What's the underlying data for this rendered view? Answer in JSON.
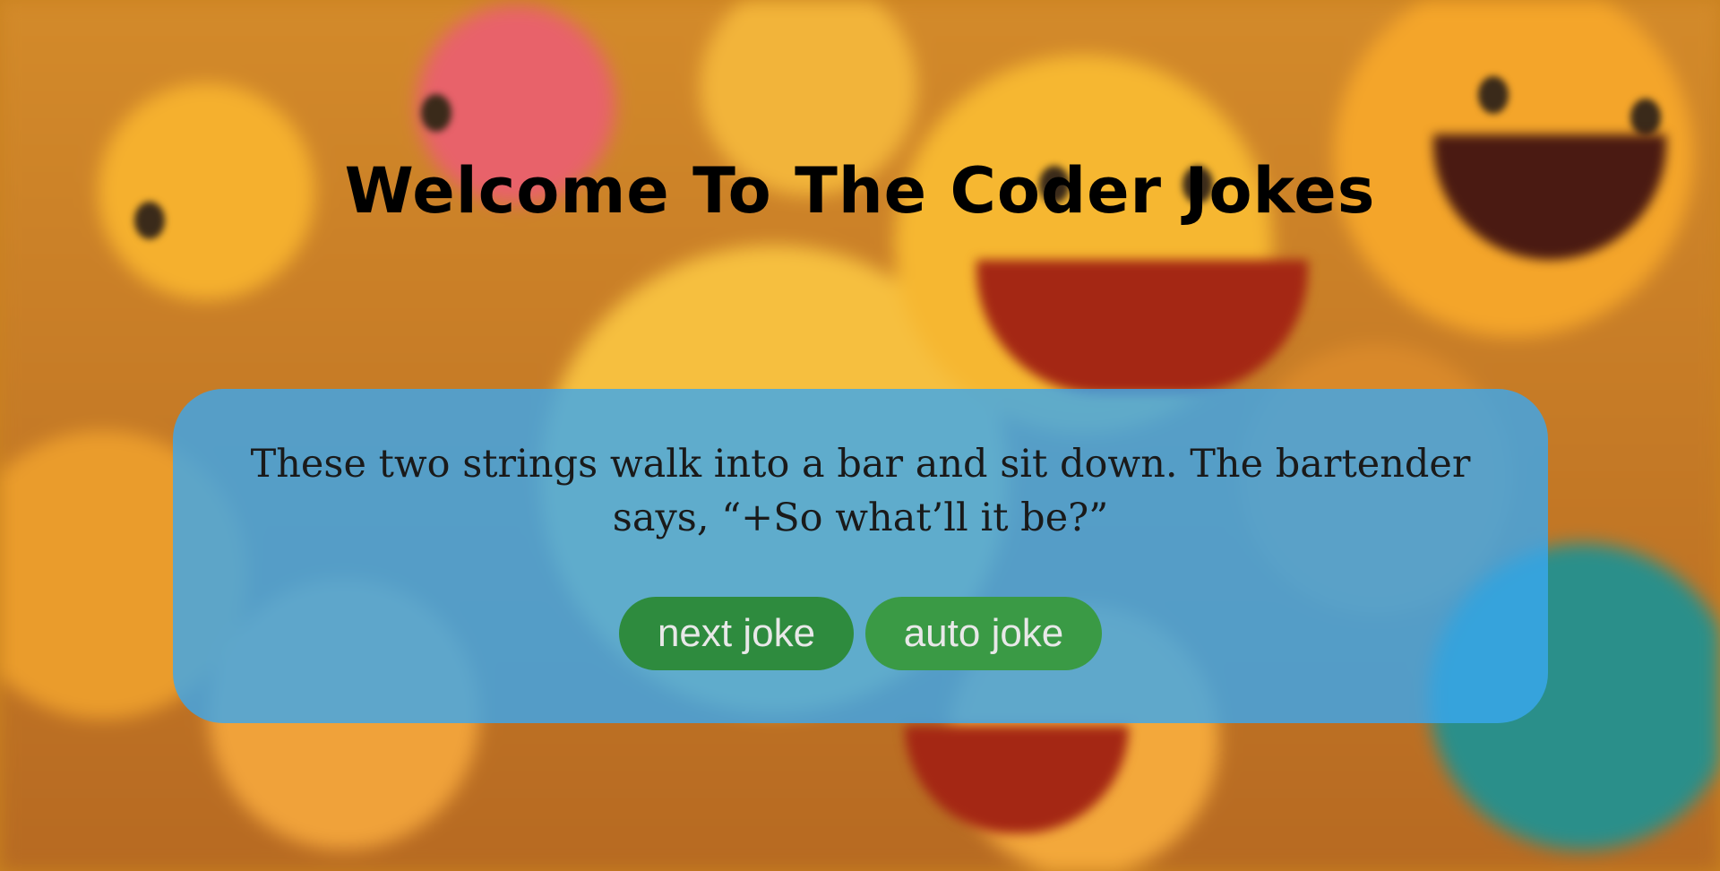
{
  "header": {
    "title": "Welcome To The Coder Jokes"
  },
  "joke_card": {
    "text": "These two strings walk into a bar and sit down. The bartender says, “+So what’ll it be?”",
    "buttons": {
      "next_label": "next joke",
      "auto_label": "auto joke"
    }
  },
  "colors": {
    "card": "#3aa8f0",
    "button": "#2e8b3e",
    "title": "#000000"
  }
}
